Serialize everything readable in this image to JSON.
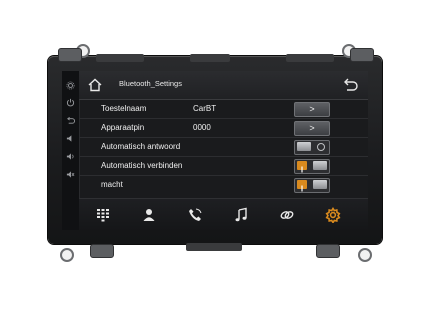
{
  "header": {
    "title": "Bluetooth_Settings",
    "home_icon": "home-icon",
    "back_icon": "back-arrow-icon"
  },
  "sidebar": {
    "icons": [
      "settings-icon",
      "power-icon",
      "back-icon",
      "volume-down-icon",
      "volume-up-icon",
      "volume-mute-icon"
    ]
  },
  "settings": {
    "rows": [
      {
        "label": "Toestelnaam",
        "value": "CarBT",
        "control": "arrow"
      },
      {
        "label": "Apparaatpin",
        "value": "0000",
        "control": "arrow"
      },
      {
        "label": "Automatisch antwoord",
        "value": "",
        "control": "toggle",
        "state": "off"
      },
      {
        "label": "Automatisch verbinden",
        "value": "",
        "control": "toggle",
        "state": "on"
      },
      {
        "label": "macht",
        "value": "",
        "control": "toggle",
        "state": "on"
      }
    ],
    "arrow_glyph": ">",
    "toggle_on_glyph": "I"
  },
  "bottom_nav": {
    "items": [
      "dialpad-icon",
      "contacts-icon",
      "call-log-icon",
      "music-icon",
      "link-icon",
      "settings-gear-icon"
    ],
    "active": "settings-gear-icon"
  },
  "colors": {
    "accent": "#d98a1e",
    "text": "#f0f0f0",
    "screen_bg": "#1a1b1d"
  }
}
